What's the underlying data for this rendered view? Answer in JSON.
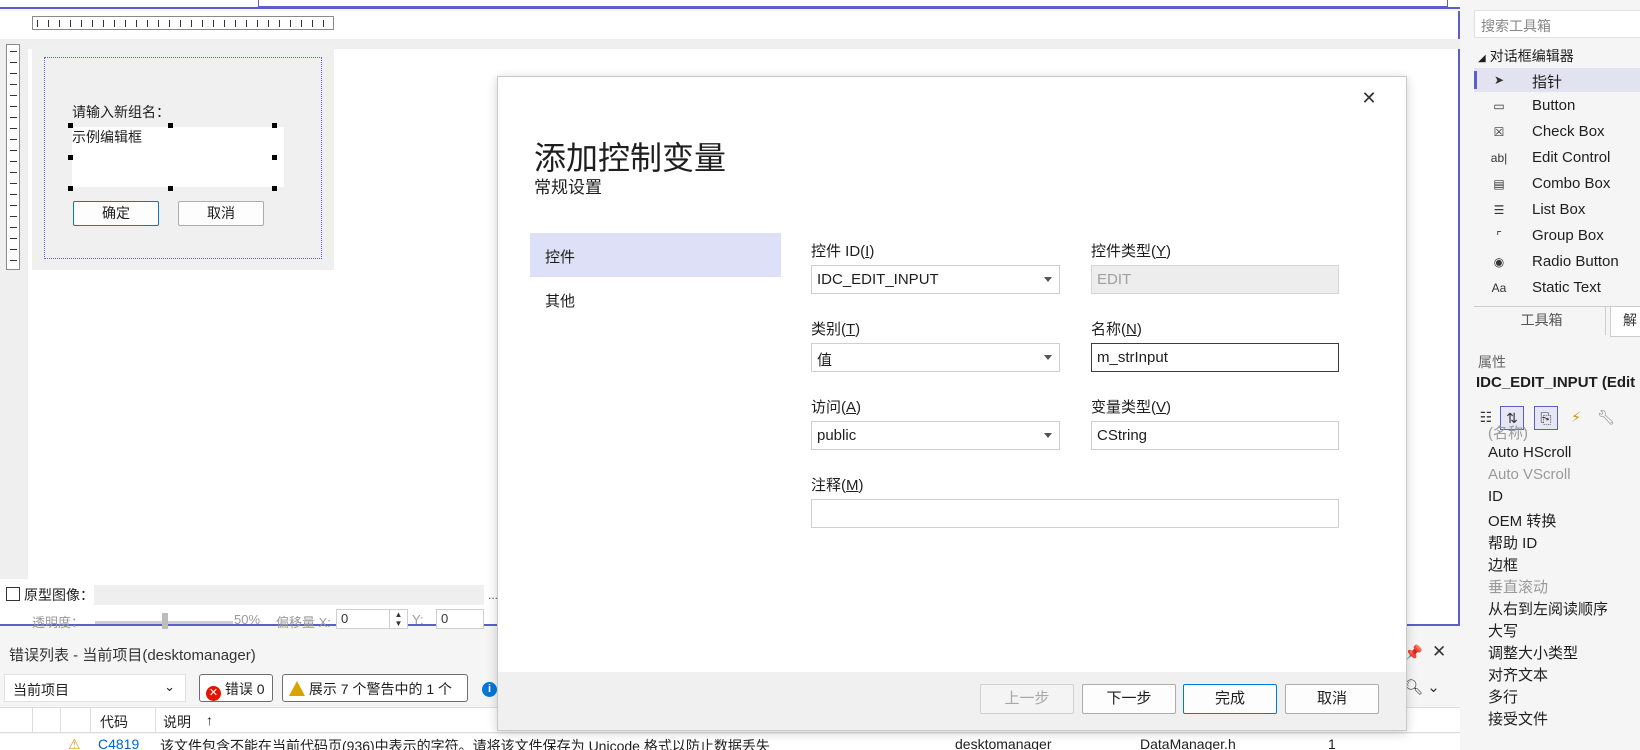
{
  "colors": {
    "accent": "#5b5fc7",
    "selection": "#dde0f6",
    "error": "#e51400",
    "warning": "#d8a200",
    "info": "#0078d4"
  },
  "designer": {
    "label_new_group": "请输入新组名：",
    "edit_sample": "示例编辑框",
    "ok_label": "确定",
    "cancel_label": "取消",
    "prototype_label": "原型图像：",
    "transparency_label": "透明度：",
    "transparency_value": "50%",
    "offset_label": "偏移量 X:",
    "offset_x": "0",
    "y_label": "Y:",
    "offset_y": "0",
    "dots": "..."
  },
  "error_list": {
    "title": "错误列表 - 当前项目(desktomanager)",
    "scope": "当前项目",
    "errors_label": "错误 0",
    "warnings_label": "展示 7 个警告中的 1 个",
    "columns": [
      "代码",
      "说明",
      "↑"
    ],
    "row": {
      "code": "C4819",
      "description": "该文件包含不能在当前代码页(936)中表示的字符。请将该文件保存为 Unicode 格式以防止数据丢失",
      "project": "desktomanager",
      "file": "DataManager.h",
      "line": "1"
    }
  },
  "toolbox": {
    "search_placeholder": "搜索工具箱",
    "group": "对话框编辑器",
    "items": [
      {
        "label": "指针",
        "icon": "pointer-icon",
        "glyph": "➤"
      },
      {
        "label": "Button",
        "icon": "button-icon",
        "glyph": "▭"
      },
      {
        "label": "Check Box",
        "icon": "checkbox-icon",
        "glyph": "☒"
      },
      {
        "label": "Edit Control",
        "icon": "edit-control-icon",
        "glyph": "ab|"
      },
      {
        "label": "Combo Box",
        "icon": "combobox-icon",
        "glyph": "▤"
      },
      {
        "label": "List Box",
        "icon": "listbox-icon",
        "glyph": "☰"
      },
      {
        "label": "Group Box",
        "icon": "groupbox-icon",
        "glyph": "⌜"
      },
      {
        "label": "Radio Button",
        "icon": "radio-icon",
        "glyph": "◉"
      },
      {
        "label": "Static Text",
        "icon": "static-text-icon",
        "glyph": "Aa"
      }
    ],
    "tab_toolbox": "工具箱",
    "tab_solution": "解"
  },
  "properties": {
    "title": "属性",
    "object": "IDC_EDIT_INPUT (Edit",
    "rows": [
      {
        "label": "(名称)",
        "dim": true
      },
      {
        "label": "Auto HScroll",
        "dim": false
      },
      {
        "label": "Auto VScroll",
        "dim": true
      },
      {
        "label": "ID",
        "dim": false
      },
      {
        "label": "OEM 转换",
        "dim": false
      },
      {
        "label": "帮助 ID",
        "dim": false
      },
      {
        "label": "边框",
        "dim": false
      },
      {
        "label": "垂直滚动",
        "dim": true
      },
      {
        "label": "从右到左阅读顺序",
        "dim": false
      },
      {
        "label": "大写",
        "dim": false
      },
      {
        "label": "调整大小类型",
        "dim": false
      },
      {
        "label": "对齐文本",
        "dim": false
      },
      {
        "label": "多行",
        "dim": false
      },
      {
        "label": "接受文件",
        "dim": false
      }
    ]
  },
  "modal": {
    "title": "添加控制变量",
    "subtitle": "常规设置",
    "nav": [
      "控件",
      "其他"
    ],
    "control_id_label": "控件 ID(",
    "control_id_key": "I",
    "control_id_value": "IDC_EDIT_INPUT",
    "control_type_label": "控件类型(",
    "control_type_key": "Y",
    "control_type_value": "EDIT",
    "category_label": "类别(",
    "category_key": "T",
    "category_value": "值",
    "name_label": "名称(",
    "name_key": "N",
    "name_value": "m_strInput",
    "access_label": "访问(",
    "access_key": "A",
    "access_value": "public",
    "var_type_label": "变量类型(",
    "var_type_key": "V",
    "var_type_value": "CString",
    "comment_label": "注释(",
    "comment_key": "M",
    "comment_value": "",
    "close_sym": ")",
    "buttons": {
      "prev": "上一步",
      "next": "下一步",
      "finish": "完成",
      "cancel": "取消"
    }
  }
}
